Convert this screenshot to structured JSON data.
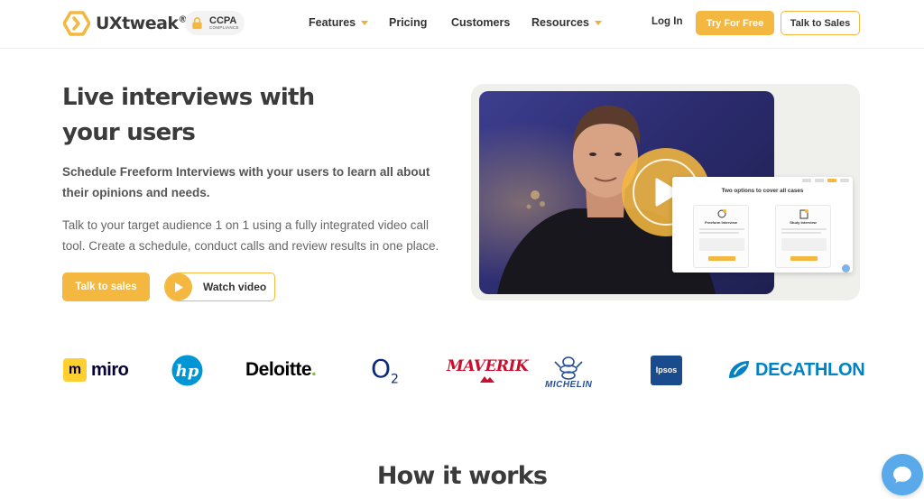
{
  "nav": {
    "logo_text": "UXtweak",
    "logo_reg": "®",
    "ccpa_main": "CCPA",
    "ccpa_sub": "COMPLIANCE",
    "features": "Features",
    "pricing": "Pricing",
    "customers": "Customers",
    "resources": "Resources",
    "login": "Log In",
    "try_free": "Try For Free",
    "talk_sales": "Talk to Sales"
  },
  "hero": {
    "title_line1": "Live interviews with",
    "title_line2": "your users",
    "subtitle": "Schedule Freeform Interviews with your users to learn all about their opinions and needs.",
    "description": "Talk to your target audience 1 on 1 using a fully integrated video call tool. Create a schedule, conduct calls and review results in one place.",
    "talk_button": "Talk to sales",
    "watch_button": "Watch video"
  },
  "mockup": {
    "title": "Two options to cover all cases",
    "option1": "Freeform Interview",
    "option2": "Study Interview"
  },
  "logos": {
    "miro": "miro",
    "miro_mark": "m",
    "hp": "hp",
    "deloitte": "Deloitte",
    "deloitte_dot": ".",
    "o2": "O",
    "o2_sub": "2",
    "maverik": "MAVERIK",
    "michelin": "MICHELIN",
    "ipsos": "Ipsos",
    "decathlon": "DECATHLON"
  },
  "section": {
    "how_title": "How it works"
  },
  "colors": {
    "accent": "#f4b73f",
    "text_dark": "#3b3b3b",
    "chat": "#5aa9ea"
  },
  "icons": {
    "logo": "hexagon-chevron-icon",
    "ccpa": "lock-icon",
    "play": "play-icon",
    "chat": "chat-bubble-icon"
  }
}
